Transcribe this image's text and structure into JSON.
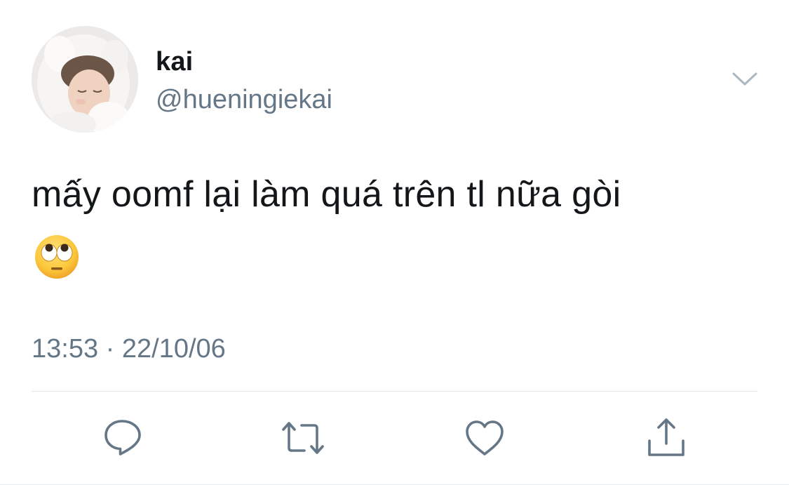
{
  "tweet": {
    "author": {
      "display_name": "kai",
      "handle": "@hueningiekai"
    },
    "text": "mấy oomf lại làm quá trên tl nữa gòi",
    "emoji": "🙄",
    "timestamp": "13:53 · 22/10/06"
  },
  "actions": [
    {
      "icon": "reply-icon"
    },
    {
      "icon": "retweet-icon"
    },
    {
      "icon": "like-icon"
    },
    {
      "icon": "share-icon"
    }
  ],
  "colors": {
    "text": "#14171a",
    "secondary": "#657786",
    "icon": "#657786",
    "divider": "#e1e8ed"
  }
}
